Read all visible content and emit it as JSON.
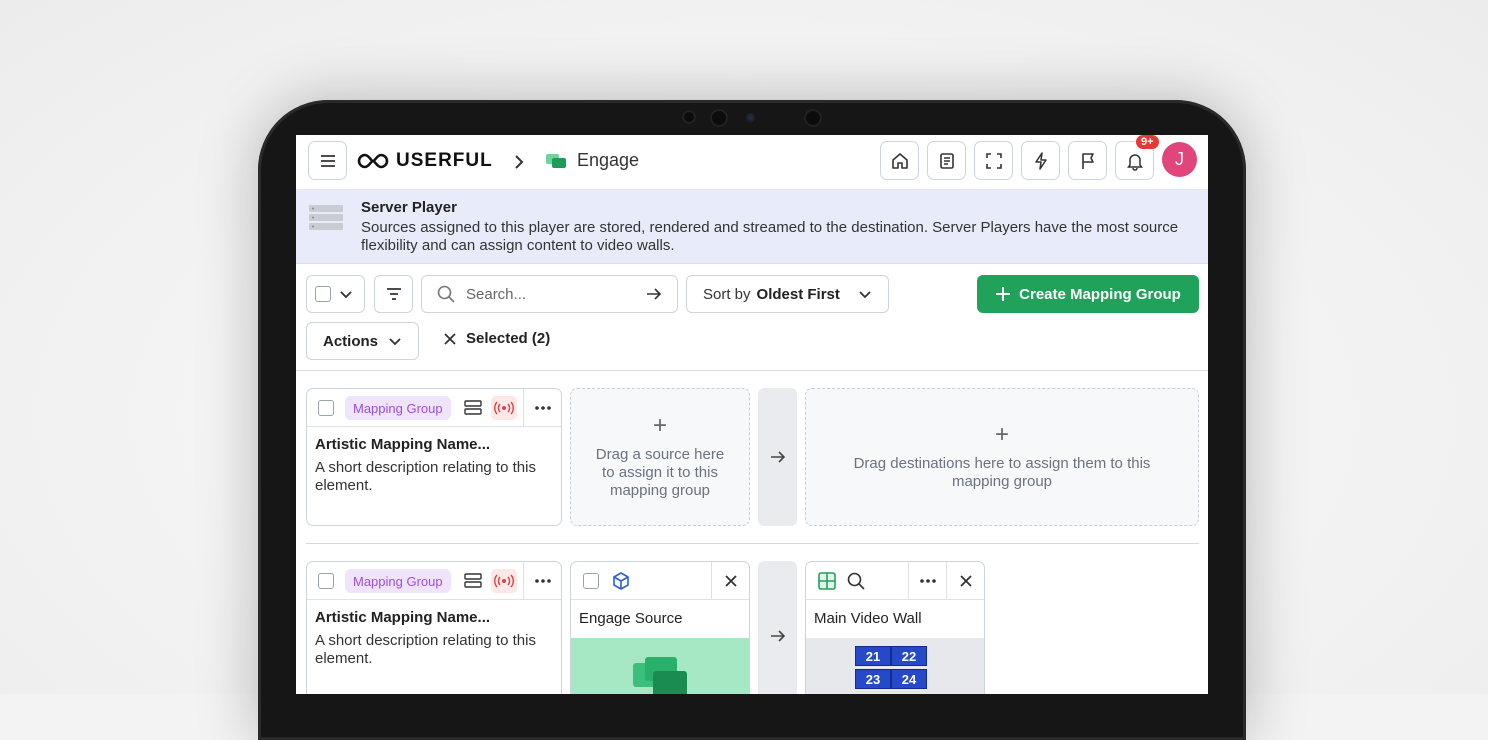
{
  "header": {
    "logo_text": "USERFUL",
    "breadcrumb_current": "Engage",
    "notification_count": "9+",
    "avatar_initial": "J"
  },
  "banner": {
    "title": "Server Player",
    "text": "Sources assigned to this player are stored, rendered and streamed to the destination. Server Players have the most source flexibility and can assign content to video walls."
  },
  "toolbar": {
    "search_placeholder": "Search...",
    "sort_label": "Sort by",
    "sort_value": "Oldest First",
    "create_label": "Create Mapping Group",
    "actions_label": "Actions",
    "selected_label": "Selected (2)"
  },
  "groups": [
    {
      "tag": "Mapping Group",
      "title": "Artistic Mapping Name...",
      "description": "A short description relating to this element.",
      "source_drop_text": "Drag a source here to assign it to this mapping group",
      "dest_drop_text": "Drag destinations here to assign them to this mapping group"
    },
    {
      "tag": "Mapping Group",
      "title": "Artistic Mapping Name...",
      "description": "A short description relating to this element.",
      "source_name": "Engage Source",
      "destination_name": "Main Video Wall",
      "wall_cells": [
        "21",
        "22",
        "23",
        "24"
      ]
    }
  ],
  "colors": {
    "primary_green": "#21a25a",
    "banner_bg": "#e8ecfa",
    "tag_bg": "#f0e3fc",
    "tag_text": "#9b4fdd",
    "avatar": "#e0457b",
    "wall_blue": "#2549c9"
  },
  "icons": [
    "menu-icon",
    "infinity-logo-icon",
    "chevron-right-icon",
    "engage-icon",
    "home-icon",
    "book-icon",
    "fullscreen-icon",
    "bolt-icon",
    "flag-icon",
    "bell-icon",
    "server-icon",
    "search-icon",
    "arrow-right-icon",
    "filter-icon",
    "chevron-down-icon",
    "plus-icon",
    "close-icon",
    "broadcast-icon",
    "more-icon",
    "cube-icon",
    "grid-icon"
  ]
}
